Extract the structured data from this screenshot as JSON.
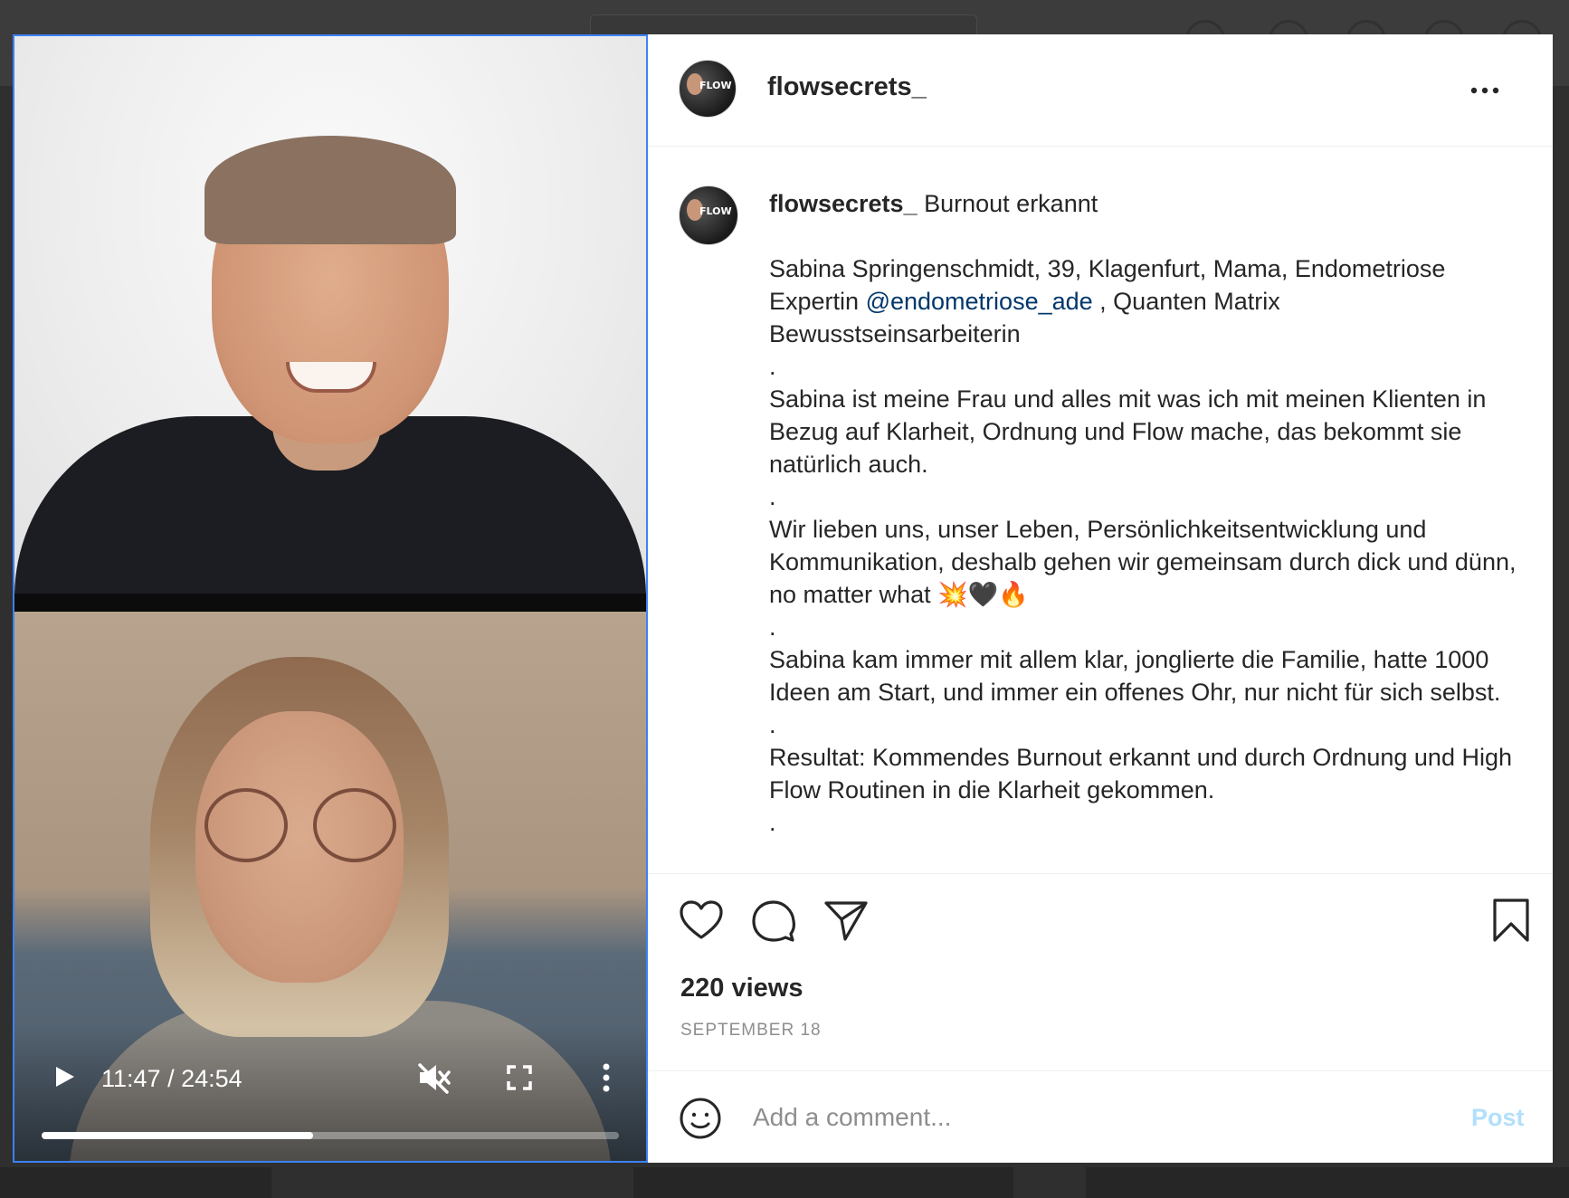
{
  "post": {
    "username": "flowsecrets_",
    "caption_title": "Burnout erkannt",
    "caption_lines": [
      "Sabina Springenschmidt, 39, Klagenfurt, Mama, Endometriose Expertin",
      "@endometriose_ade",
      ", Quanten Matrix Bewusstseinsarbeiterin"
    ],
    "dot": ".",
    "paragraph_2": "Sabina ist meine Frau und alles mit was ich mit meinen Klienten in Bezug auf Klarheit, Ordnung und Flow mache, das bekommt sie natürlich auch.",
    "paragraph_3": "Wir lieben uns, unser Leben, Persönlichkeitsentwicklung und Kommunikation, deshalb gehen wir gemeinsam durch dick und dünn, no matter what 💥🖤🔥",
    "paragraph_4": "Sabina kam immer mit allem klar, jonglierte die Familie, hatte 1000 Ideen am Start, und immer ein offenes Ohr, nur nicht für sich selbst.",
    "paragraph_5": "Resultat: Kommendes Burnout erkannt und durch Ordnung und High Flow Routinen in die Klarheit gekommen.",
    "views": "220 views",
    "date": "SEPTEMBER 18",
    "avatar_text": "FLOW"
  },
  "video": {
    "time": "11:47 / 24:54",
    "progress": 0.47
  },
  "comment": {
    "placeholder": "Add a comment...",
    "post_label": "Post"
  },
  "icons": {
    "play": "play-icon",
    "mute": "muted-speaker-icon",
    "fullscreen": "fullscreen-icon",
    "more_vertical": "kebab-icon",
    "more_horizontal": "ellipsis-icon",
    "like": "heart-icon",
    "comment": "speech-bubble-icon",
    "share": "paper-plane-icon",
    "save": "bookmark-icon",
    "emoji": "smiley-icon"
  },
  "colors": {
    "link": "#00376b",
    "post_disabled": "#b2dffc",
    "text": "#262626",
    "muted": "#8e8e8e"
  }
}
